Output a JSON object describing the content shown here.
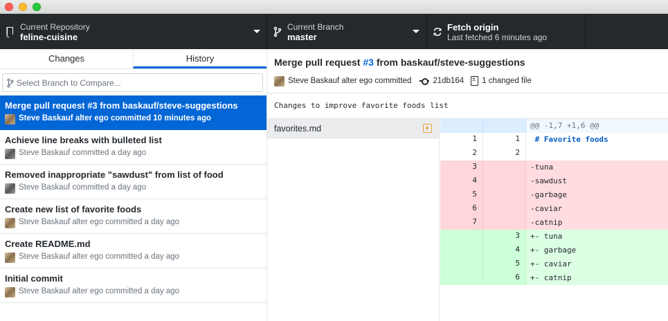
{
  "toolbar": {
    "repo": {
      "small": "Current Repository",
      "big": "feline-cuisine"
    },
    "branch": {
      "small": "Current Branch",
      "big": "master"
    },
    "fetch": {
      "big": "Fetch origin",
      "small": "Last fetched 6 minutes ago"
    }
  },
  "sidebar": {
    "tabs": [
      {
        "label": "Changes"
      },
      {
        "label": "History"
      }
    ],
    "compare_placeholder": "Select Branch to Compare...",
    "commits": [
      {
        "title": "Merge pull request #3 from baskauf/steve-suggestions",
        "meta": "Steve Baskauf alter ego committed 10 minutes ago"
      },
      {
        "title": "Achieve line breaks with bulleted list",
        "meta": "Steve Baskauf committed a day ago"
      },
      {
        "title": "Removed inappropriate \"sawdust\" from list of food",
        "meta": "Steve Baskauf committed a day ago"
      },
      {
        "title": "Create new list of favorite foods",
        "meta": "Steve Baskauf alter ego committed a day ago"
      },
      {
        "title": "Create README.md",
        "meta": "Steve Baskauf alter ego committed a day ago"
      },
      {
        "title": "Initial commit",
        "meta": "Steve Baskauf alter ego committed a day ago"
      }
    ]
  },
  "detail": {
    "title_prefix": "Merge pull request ",
    "title_pr": "#3",
    "title_suffix": " from baskauf/steve-suggestions",
    "author": "Steve Baskauf alter ego committed",
    "sha": "21db164",
    "changed_files": "1 changed file",
    "description": "Changes to improve favorite foods list",
    "file": "favorites.md"
  },
  "diff": {
    "hunk": "@@ -1,7 +1,6 @@",
    "lines": [
      {
        "type": "ctx",
        "old": "1",
        "new": "1",
        "text": " # Favorite foods"
      },
      {
        "type": "ctx",
        "old": "2",
        "new": "2",
        "text": ""
      },
      {
        "type": "del",
        "old": "3",
        "new": "",
        "text": "-tuna"
      },
      {
        "type": "del",
        "old": "4",
        "new": "",
        "text": "-sawdust"
      },
      {
        "type": "del",
        "old": "5",
        "new": "",
        "text": "-garbage"
      },
      {
        "type": "del",
        "old": "6",
        "new": "",
        "text": "-caviar"
      },
      {
        "type": "del",
        "old": "7",
        "new": "",
        "text": "-catnip"
      },
      {
        "type": "add",
        "old": "",
        "new": "3",
        "text": "+- tuna"
      },
      {
        "type": "add",
        "old": "",
        "new": "4",
        "text": "+- garbage"
      },
      {
        "type": "add",
        "old": "",
        "new": "5",
        "text": "+- caviar"
      },
      {
        "type": "add",
        "old": "",
        "new": "6",
        "text": "+- catnip"
      }
    ]
  },
  "colors": {
    "accent": "#0366d6",
    "toolbar": "#24292e",
    "deleted": "#ffdce0",
    "added": "#dcffe4",
    "modified": "#e4a33b"
  }
}
